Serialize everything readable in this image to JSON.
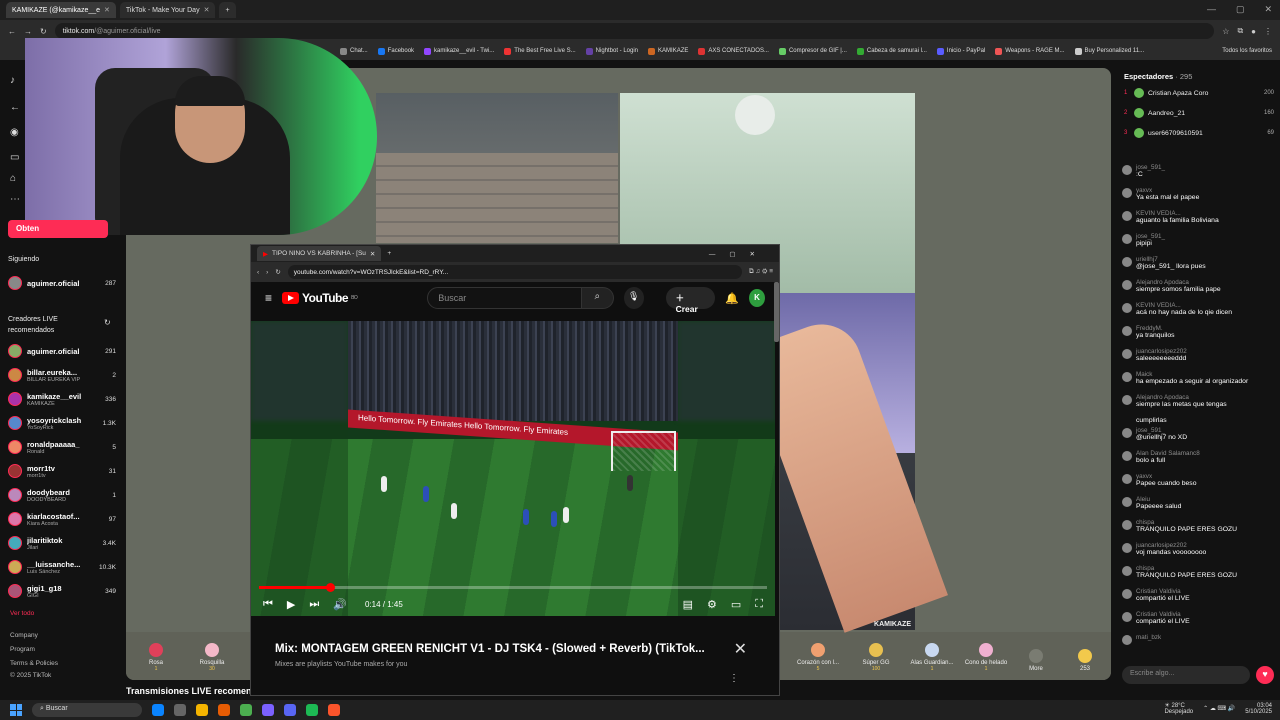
{
  "browser": {
    "tabs": [
      {
        "label": "KAMIKAZE (@kamikaze__e"
      },
      {
        "label": "TikTok - Make Your Day"
      }
    ],
    "url_host": "tiktok.com",
    "url_path": "/@aguimer.oficial/live",
    "bookmarks": [
      "Chat...",
      "Facebook",
      "kamikaze__evil - Twi...",
      "The Best Free Live S...",
      "Nightbot - Login",
      "KAMIKAZE",
      "AXS CONECTADOS...",
      "Compresor de GIF |...",
      "Cabeza de samurai l...",
      "Inicio - PayPal",
      "Weapons - RAGE M...",
      "Buy Personalized 11..."
    ],
    "bookmarks_all": "Todos los favoritos"
  },
  "leftnav": {
    "obtain_label": "Obten",
    "following_header": "Siguiendo",
    "following": [
      {
        "name": "aguimer.oficial",
        "count": "287"
      }
    ],
    "recommended_header": "Creadores LIVE recomendados",
    "channels": [
      {
        "name": "aguimer.oficial",
        "sub": "",
        "count": "291"
      },
      {
        "name": "billar.eureka...",
        "sub": "BILLAR EUREKA VIP",
        "count": "2"
      },
      {
        "name": "kamikaze__evil",
        "sub": "KAMIKAZE",
        "count": "336"
      },
      {
        "name": "yosoyrickclash",
        "sub": "YoSoyRick",
        "count": "1.3K"
      },
      {
        "name": "ronaldpaaaaa_",
        "sub": "Ronald",
        "count": "5"
      },
      {
        "name": "morr1tv",
        "sub": "morr1tv",
        "count": "31"
      },
      {
        "name": "doodybeard",
        "sub": "DOODYBEARD",
        "count": "1"
      },
      {
        "name": "kiarlacostaof...",
        "sub": "Kiara Acosta",
        "count": "97"
      },
      {
        "name": "jilaritiktok",
        "sub": "Jilari",
        "count": "3.4K"
      },
      {
        "name": "__luissanche...",
        "sub": "Luis Sánchez",
        "count": "10.3K"
      },
      {
        "name": "gigi1_g18",
        "sub": "GIGI",
        "count": "349"
      }
    ],
    "see_all": "Ver todo",
    "footer": [
      "Company",
      "Program",
      "Terms & Policies",
      "© 2025 TikTok"
    ]
  },
  "stream": {
    "watermark": "KAMIKAZE",
    "more_live": "Transmisiones LIVE recomen",
    "gifts_left": [
      {
        "name": "Rosa",
        "cost": "1"
      },
      {
        "name": "Rosquilla",
        "cost": "30"
      }
    ],
    "gifts_right": [
      {
        "name": "Corazón con l...",
        "cost": "5"
      },
      {
        "name": "Súper GG",
        "cost": "100"
      },
      {
        "name": "Alas Guardian...",
        "cost": "1"
      },
      {
        "name": "Cono de helado",
        "cost": "1"
      },
      {
        "name": "More",
        "cost": ""
      }
    ],
    "coins": "253"
  },
  "youtube": {
    "tab_title": "TIPO NINO VS KABRINHA - [Su",
    "url": "youtube.com/watch?v=WOzTRSJlckE&list=RD_rRY...",
    "logo_suffix": "BO",
    "logo_text": "YouTube",
    "search_placeholder": "Buscar",
    "create_label": "Crear",
    "avatar_letter": "K",
    "banner_text": "Hello Tomorrow.   Fly Emirates   Hello Tomorrow.   Fly Emirates",
    "time": "0:14 / 1:45",
    "progress": 0.14,
    "mix_title": "Mix: MONTAGEM GREEN RENICHT V1 - DJ TSK4 - (Slowed + Reverb) (TikTok...",
    "mix_sub": "Mixes are playlists YouTube makes for you"
  },
  "chat": {
    "viewers_label": "Espectadores",
    "viewers_count": "· 295",
    "top_viewers": [
      {
        "rank": "1",
        "name": "Cristian Apaza Coro",
        "score": "200"
      },
      {
        "rank": "2",
        "name": "Aandreo_21",
        "score": "160"
      },
      {
        "rank": "3",
        "name": "user66709610591",
        "score": "69"
      }
    ],
    "messages": [
      {
        "user": "jose_591_",
        "text": ":C"
      },
      {
        "user": "yaxvx",
        "text": "Ya esta mal el papee"
      },
      {
        "user": "KEVIN VEDIA...",
        "text": "aguanto la familia Boliviana"
      },
      {
        "user": "jose_591_",
        "text": "pipipi"
      },
      {
        "user": "uriellhj7",
        "text": "@jose_591_ llora pues"
      },
      {
        "user": "Alejandro Apodaca",
        "text": "siempre somos familia pape"
      },
      {
        "user": "KEVIN VEDIA...",
        "text": "acá no hay nada de lo qie dicen"
      },
      {
        "user": "FreddyM.",
        "text": "ya tranquilos"
      },
      {
        "user": "juancarlosipez202",
        "text": "saleeeeeeeeddd"
      },
      {
        "user": "Maick",
        "text": "ha empezado a seguir al organizador"
      },
      {
        "user": "Alejandro Apodaca",
        "text": "siempre las metas que tengas"
      },
      {
        "user": "",
        "text": "cumplirlas"
      },
      {
        "user": "jose_591_",
        "text": "@uriellhj7 no XD"
      },
      {
        "user": "Alan David Salamanc8",
        "text": "bolo a full"
      },
      {
        "user": "yaxvx",
        "text": "Papee cuando beso"
      },
      {
        "user": "Aleiu",
        "text": "Papeeee salud"
      },
      {
        "user": "chispa",
        "text": "TRANQUILO PAPE ERES GOZU"
      },
      {
        "user": "juancarlosipez202",
        "text": "voj mandas voooooooo"
      },
      {
        "user": "chispa",
        "text": "TRANQUILO PAPE ERES GOZU"
      },
      {
        "user": "Cristian Valdivia",
        "text": "compartió el LIVE"
      },
      {
        "user": "Cristian Valdivia",
        "text": "compartió el LIVE"
      },
      {
        "user": "mati_bzk",
        "text": ""
      },
      {
        "user": "yhomp",
        "text": "se unió"
      }
    ],
    "input_placeholder": "Escribe algo..."
  },
  "taskbar": {
    "search": "Buscar",
    "weather_temp": "28°C",
    "weather_desc": "Despejado",
    "time": "03:04",
    "date": "5/10/2025"
  }
}
